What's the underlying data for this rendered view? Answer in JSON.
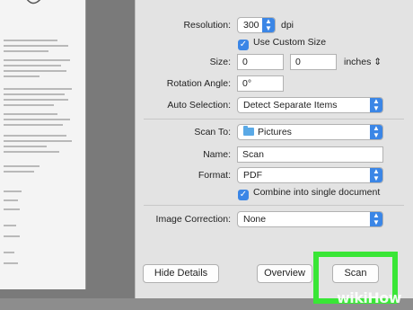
{
  "preview": {
    "scanned_page": "document-preview"
  },
  "settings": {
    "resolution_label": "Resolution:",
    "resolution_value": "300",
    "resolution_unit": "dpi",
    "use_custom_size_label": "Use Custom Size",
    "size_label": "Size:",
    "size_width": "0",
    "size_height": "0",
    "size_unit": "inches",
    "rotation_label": "Rotation Angle:",
    "rotation_value": "0°",
    "auto_selection_label": "Auto Selection:",
    "auto_selection_value": "Detect Separate Items",
    "scan_to_label": "Scan To:",
    "scan_to_value": "Pictures",
    "name_label": "Name:",
    "name_value": "Scan",
    "format_label": "Format:",
    "format_value": "PDF",
    "combine_label": "Combine into single document",
    "image_correction_label": "Image Correction:",
    "image_correction_value": "None"
  },
  "buttons": {
    "hide_details": "Hide Details",
    "overview": "Overview",
    "scan": "Scan"
  },
  "watermark": "wikiHow",
  "colors": {
    "accent": "#3b86e6",
    "highlight": "#39e636",
    "panel": "#e3e3e3"
  }
}
